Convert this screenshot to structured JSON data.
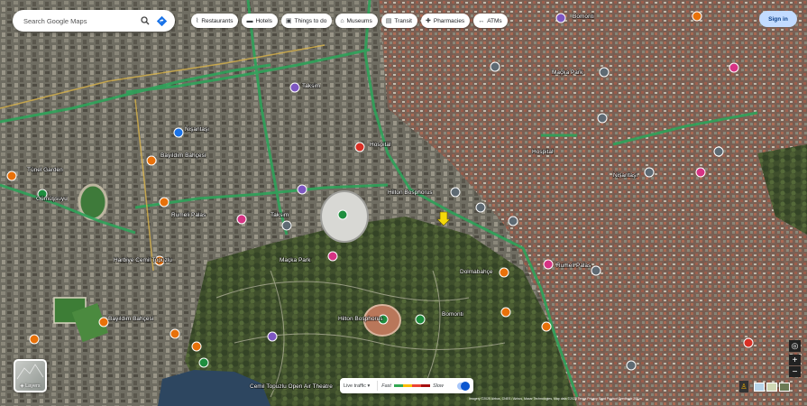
{
  "search": {
    "placeholder": "Search Google Maps"
  },
  "chips": [
    {
      "icon": "restaurant-icon",
      "glyph": "⌇",
      "label": "Restaurants"
    },
    {
      "icon": "hotel-icon",
      "glyph": "▬",
      "label": "Hotels"
    },
    {
      "icon": "camera-icon",
      "glyph": "▣",
      "label": "Things to do"
    },
    {
      "icon": "museum-icon",
      "glyph": "⌂",
      "label": "Museums"
    },
    {
      "icon": "transit-icon",
      "glyph": "▤",
      "label": "Transit"
    },
    {
      "icon": "pharmacy-icon",
      "glyph": "✚",
      "label": "Pharmacies"
    },
    {
      "icon": "atm-icon",
      "glyph": "↔",
      "label": "ATMs"
    }
  ],
  "signin": {
    "label": "Sign in"
  },
  "layers": {
    "label": "Layers"
  },
  "traffic": {
    "live_label": "Live traffic ▾",
    "fast": "Fast",
    "slow": "Slow"
  },
  "attribution": "Imagery ©2025 Airbus, CNES / Airbus, Maxar Technologies, Map data ©2025   Terms   Privacy   Send Product Feedback   200 m",
  "colors": {
    "road_traffic": "#2ea35a",
    "road_major": "#d9b34a",
    "chip_bg": "#ffffff",
    "signin_bg": "#c2dbff",
    "pin_yellow": "#f5d90a"
  },
  "places": [
    {
      "name": "Tünel Garden",
      "icon": "restaurant-pin-icon",
      "color": "#e8710a"
    },
    {
      "name": "Rumeli Palas",
      "icon": "hotel-pin-icon",
      "color": "#d63384"
    },
    {
      "name": "Taksim",
      "icon": "attraction-pin-icon",
      "color": "#7e57c2"
    },
    {
      "name": "Harbiye Cemil Topuzlu",
      "icon": "transit-pin-icon",
      "color": "#5e6a73"
    },
    {
      "name": "Cemil Topuzlu Open Air Theatre",
      "icon": "venue-pin-icon",
      "color": "#5e6a73"
    },
    {
      "name": "Hilton Bosphorus",
      "icon": "hotel-pin-icon",
      "color": "#d63384"
    },
    {
      "name": "Hospital",
      "icon": "hospital-pin-icon",
      "color": "#d93025"
    },
    {
      "name": "Maçka Park",
      "icon": "park-pin-icon",
      "color": "#1e8e3e"
    },
    {
      "name": "Bomonti",
      "icon": "museum-pin-icon",
      "color": "#7e57c2"
    },
    {
      "name": "Bayıldım Bahçesi",
      "icon": "restaurant-pin-icon",
      "color": "#e8710a"
    },
    {
      "name": "Nişantaşı",
      "icon": "attraction-pin-icon",
      "color": "#5e6a73"
    },
    {
      "name": "Gümüşsuyu Park",
      "icon": "park-pin-icon",
      "color": "#1e8e3e"
    },
    {
      "name": "Dolmabahçe",
      "icon": "museum-pin-icon",
      "color": "#7e57c2"
    }
  ]
}
